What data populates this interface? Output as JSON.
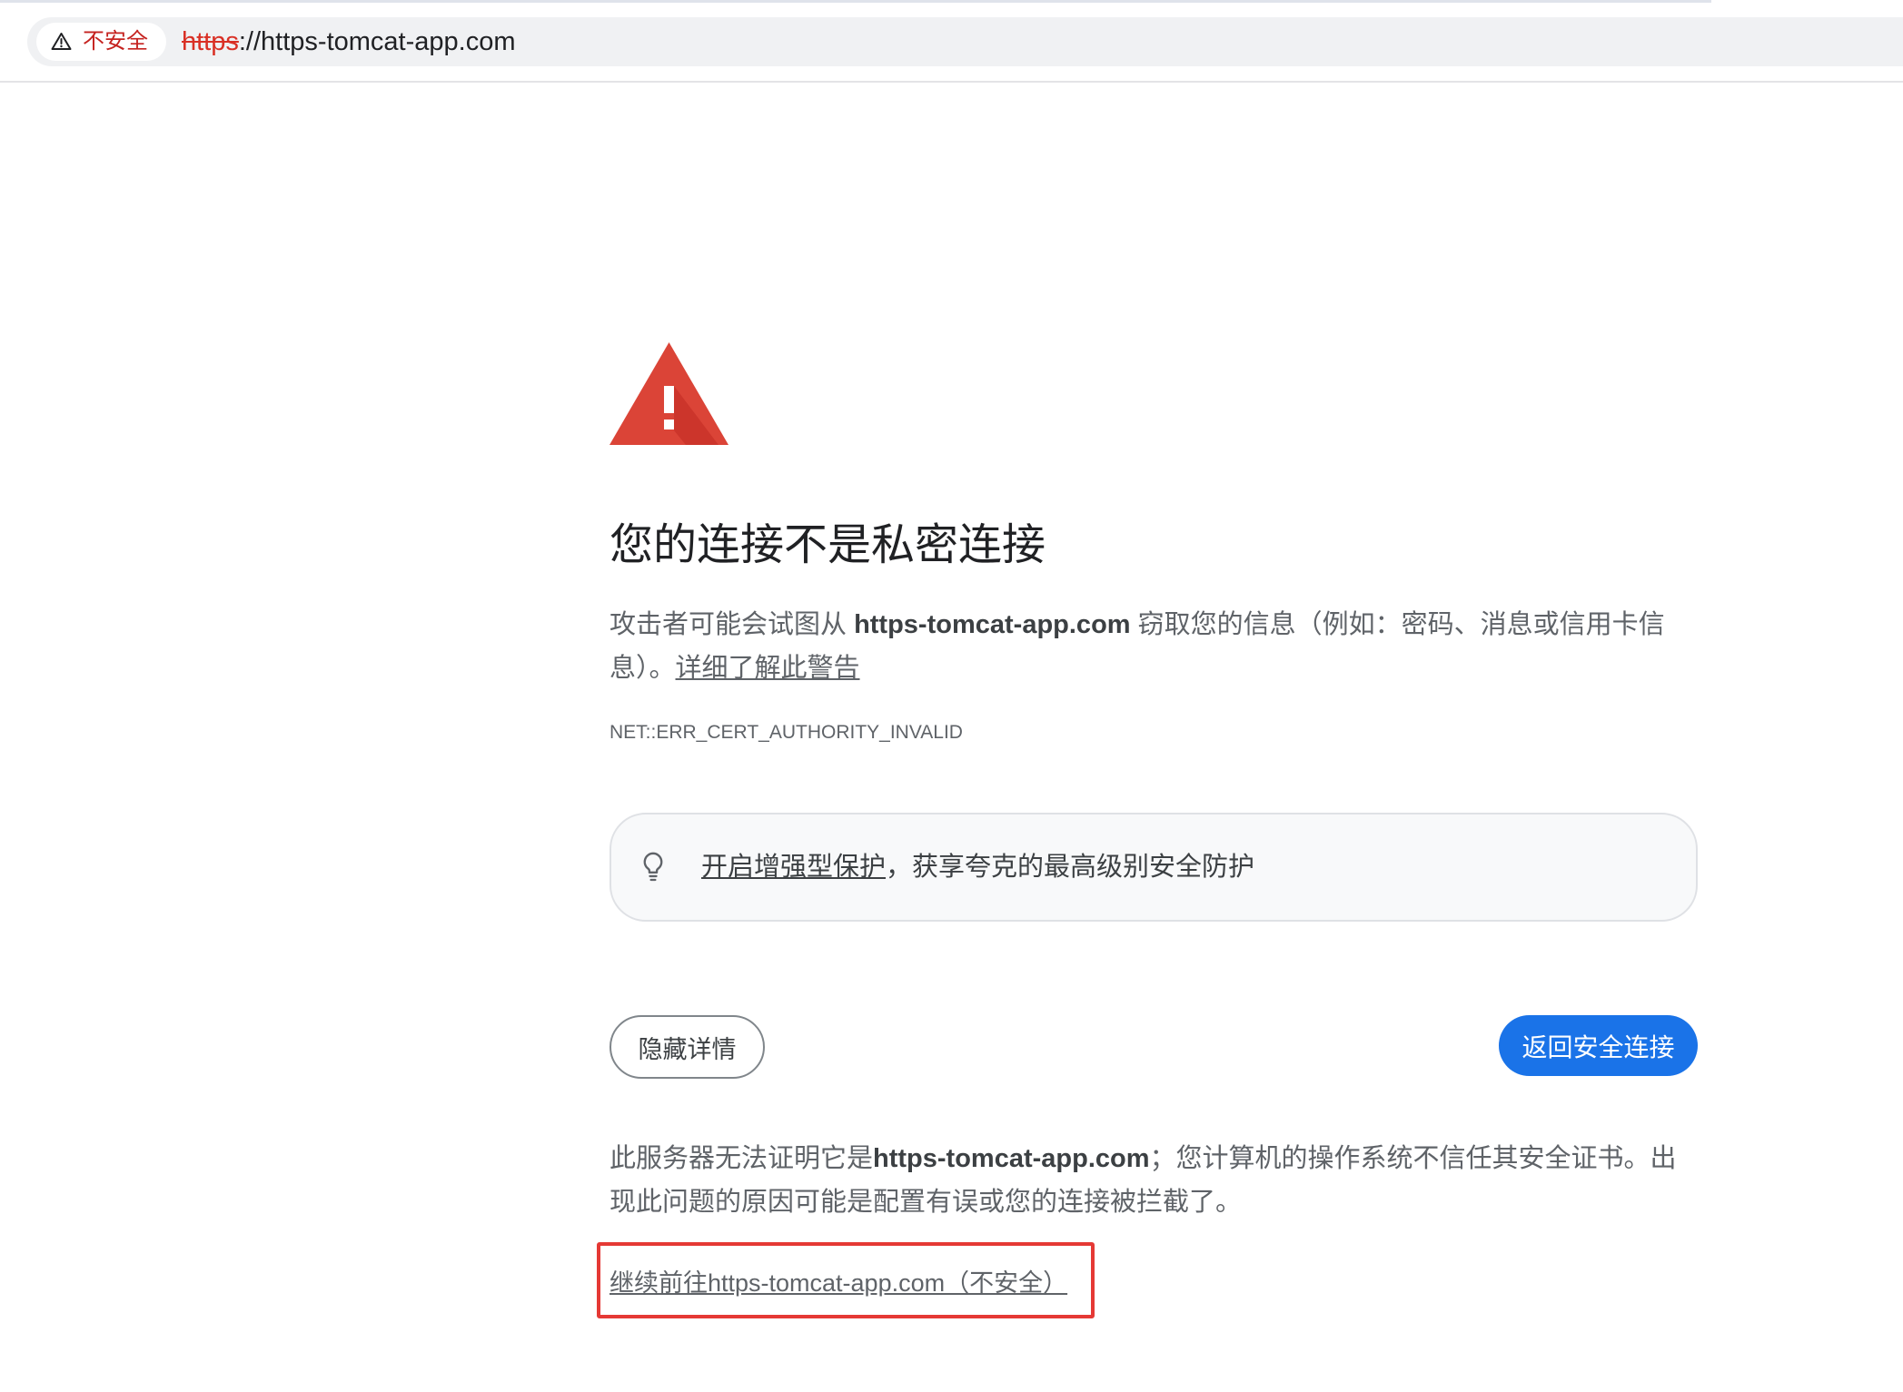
{
  "browser": {
    "security_chip": {
      "icon": "warning-triangle-outline-icon",
      "label": "不安全"
    },
    "url": {
      "scheme": "https",
      "rest": "://https-tomcat-app.com"
    }
  },
  "interstitial": {
    "icon": "red-warning-triangle-icon",
    "heading": "您的连接不是私密连接",
    "intro": {
      "before": "攻击者可能会试图从 ",
      "domain": "https-tomcat-app.com",
      "after": " 窃取您的信息（例如：密码、消息或信用卡信息）。",
      "learn_more_link": "详细了解此警告"
    },
    "error_code": "NET::ERR_CERT_AUTHORITY_INVALID",
    "enhanced_protection": {
      "icon": "lightbulb-icon",
      "link": "开启增强型保护",
      "text": "，获享夸克的最高级别安全防护"
    },
    "buttons": {
      "hide_details": "隐藏详情",
      "back_to_safety": "返回安全连接"
    },
    "details": {
      "before": "此服务器无法证明它是",
      "domain": "https-tomcat-app.com",
      "after": "；您计算机的操作系统不信任其安全证书。出现此问题的原因可能是配置有误或您的连接被拦截了。",
      "proceed_link": "继续前往https-tomcat-app.com（不安全）"
    }
  },
  "colors": {
    "accent": "#1a73e8",
    "danger": "#d93025",
    "annotation": "#e53935"
  }
}
